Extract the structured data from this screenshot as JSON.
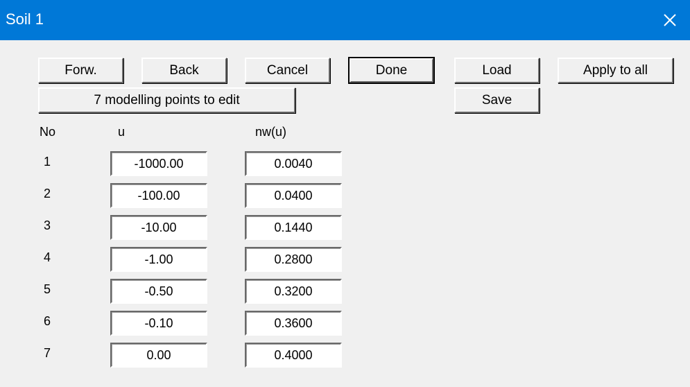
{
  "window": {
    "title": "Soil 1",
    "close_icon": "close-icon",
    "accent_color": "#0078d7"
  },
  "toolbar": {
    "forw_label": "Forw.",
    "back_label": "Back",
    "cancel_label": "Cancel",
    "done_label": "Done",
    "load_label": "Load",
    "apply_all_label": "Apply to all",
    "modelling_points_label": "7 modelling points to edit",
    "save_label": "Save"
  },
  "table": {
    "headers": {
      "no": "No",
      "u": "u",
      "nw": "nw(u)"
    },
    "rows": [
      {
        "no": "1",
        "u": "-1000.00",
        "nw": "0.0040"
      },
      {
        "no": "2",
        "u": "-100.00",
        "nw": "0.0400"
      },
      {
        "no": "3",
        "u": "-10.00",
        "nw": "0.1440"
      },
      {
        "no": "4",
        "u": "-1.00",
        "nw": "0.2800"
      },
      {
        "no": "5",
        "u": "-0.50",
        "nw": "0.3200"
      },
      {
        "no": "6",
        "u": "-0.10",
        "nw": "0.3600"
      },
      {
        "no": "7",
        "u": "0.00",
        "nw": "0.4000"
      }
    ]
  }
}
